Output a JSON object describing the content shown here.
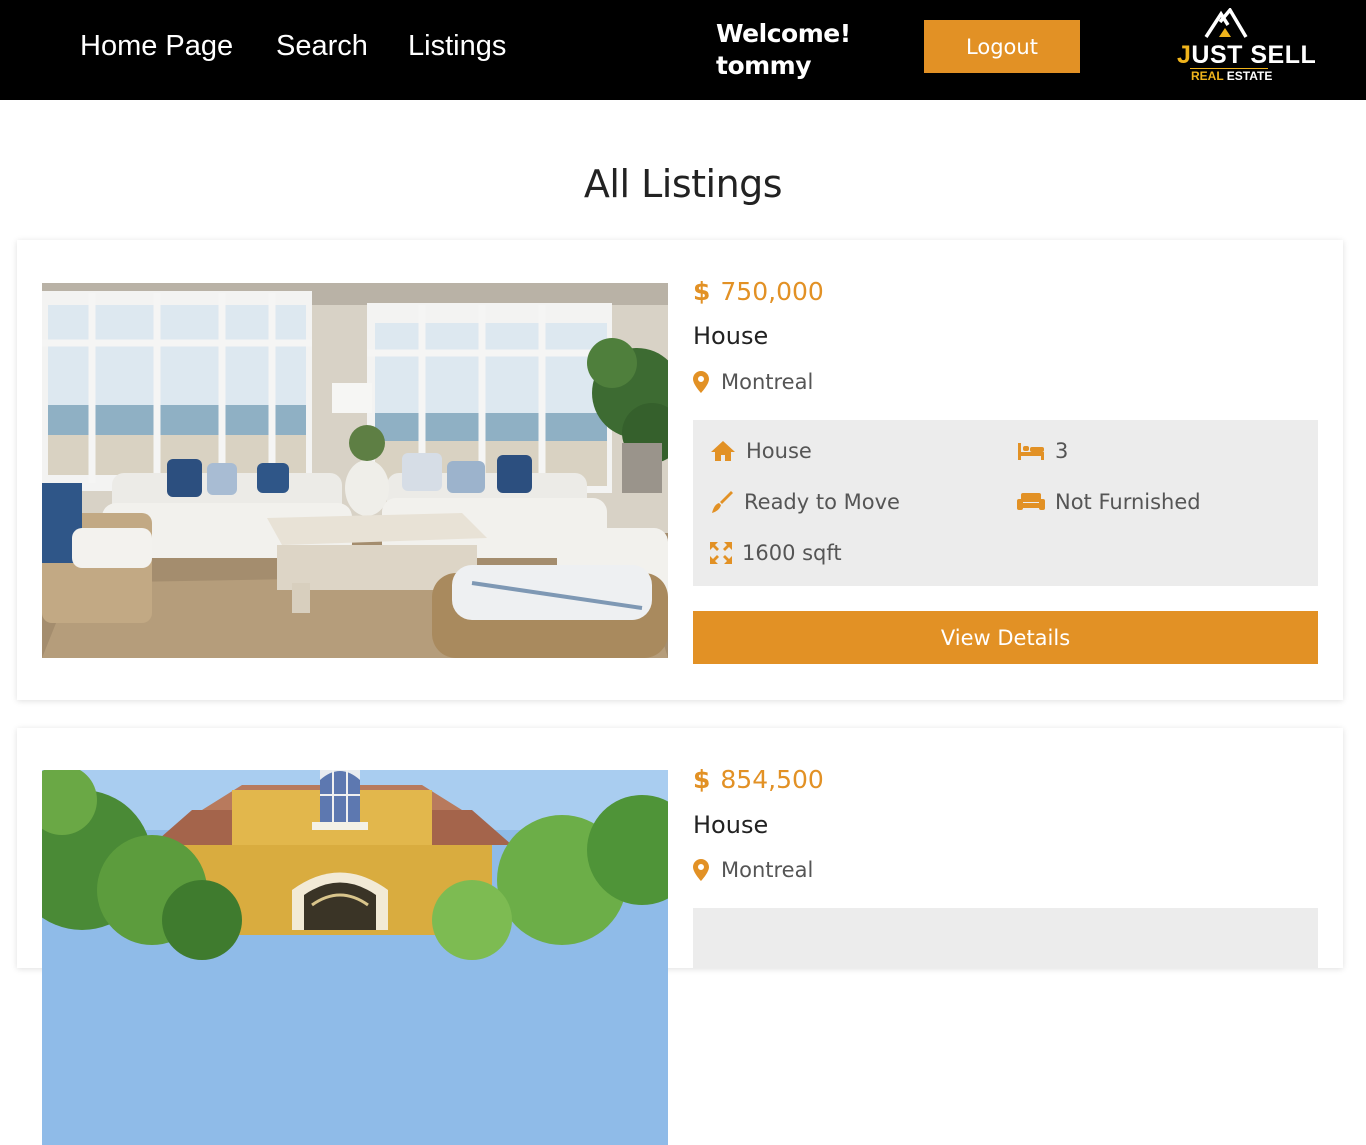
{
  "nav": {
    "links": [
      "Home Page",
      "Search",
      "Listings"
    ],
    "welcome_line1": "Welcome!",
    "welcome_line2": "tommy",
    "logout_label": "Logout",
    "logo": {
      "word_first": "J",
      "word_rest": "UST SELL",
      "sub_real": "REAL",
      "sub_estate": "ESTATE"
    }
  },
  "page": {
    "title": "All Listings"
  },
  "listings": [
    {
      "currency_symbol": "$",
      "price": "750,000",
      "type": "House",
      "location": "Montreal",
      "features": {
        "property_type": "House",
        "bedrooms": "3",
        "status": "Ready to Move",
        "furnishing": "Not Furnished",
        "area": "1600 sqft"
      },
      "button_label": "View Details",
      "image": "living-room-photo"
    },
    {
      "currency_symbol": "$",
      "price": "854,500",
      "type": "House",
      "location": "Montreal",
      "image": "house-exterior-photo"
    }
  ],
  "colors": {
    "accent": "#e29125",
    "nav_bg": "#000000",
    "feature_bg": "#ececec",
    "logo_gold": "#f0b41c"
  }
}
